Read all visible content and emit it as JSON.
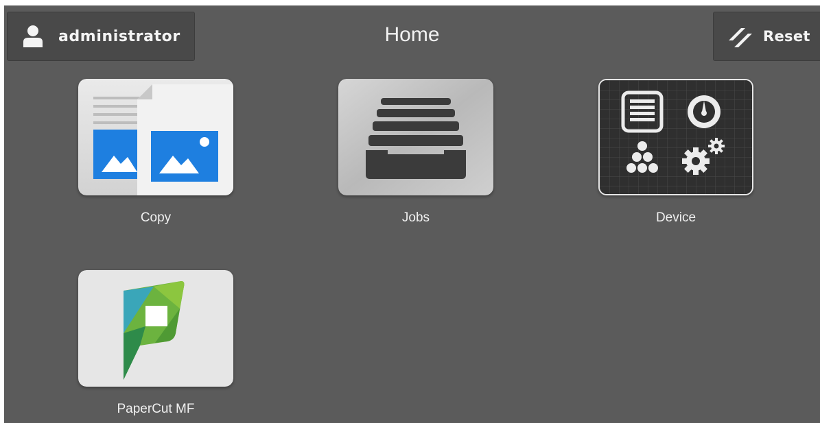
{
  "header": {
    "user_label": "administrator",
    "title": "Home",
    "reset_label": "Reset"
  },
  "apps": [
    {
      "label": "Copy",
      "icon": "copy-icon"
    },
    {
      "label": "Jobs",
      "icon": "jobs-icon"
    },
    {
      "label": "Device",
      "icon": "device-icon"
    },
    {
      "label": "PaperCut MF",
      "icon": "papercut-icon"
    }
  ],
  "colors": {
    "background": "#5b5b5b",
    "header_button": "#494949",
    "text": "#f2f2f2",
    "copy_blue": "#1e7fe0",
    "papercut_green": "#6cb33f"
  }
}
